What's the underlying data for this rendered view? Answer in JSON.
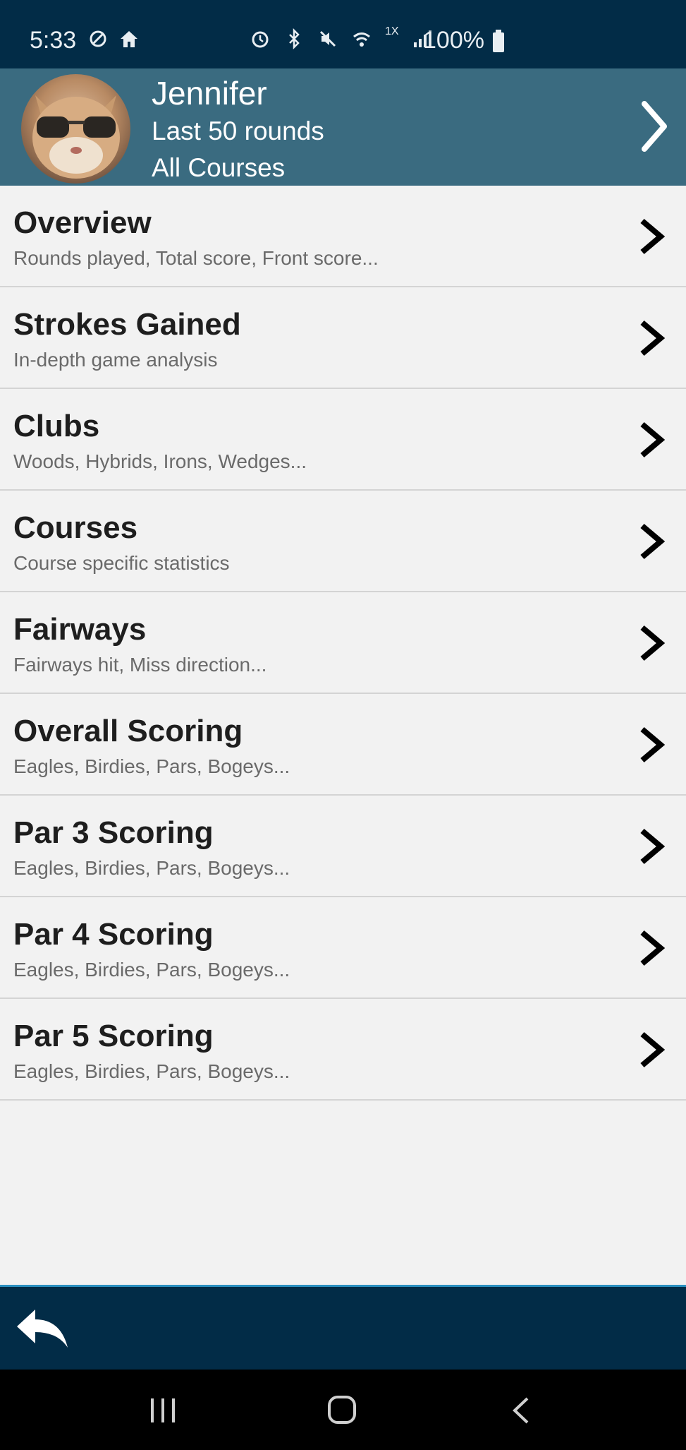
{
  "status_bar": {
    "time": "5:33",
    "network_label": "1X",
    "battery": "100%"
  },
  "profile": {
    "name": "Jennifer",
    "rounds": "Last 50 rounds",
    "courses": "All Courses"
  },
  "menu": {
    "items": [
      {
        "title": "Overview",
        "subtitle": "Rounds played, Total score, Front score..."
      },
      {
        "title": "Strokes Gained",
        "subtitle": "In-depth game analysis"
      },
      {
        "title": "Clubs",
        "subtitle": "Woods, Hybrids, Irons, Wedges..."
      },
      {
        "title": "Courses",
        "subtitle": "Course specific statistics"
      },
      {
        "title": "Fairways",
        "subtitle": "Fairways hit, Miss direction..."
      },
      {
        "title": "Overall Scoring",
        "subtitle": "Eagles, Birdies, Pars, Bogeys..."
      },
      {
        "title": "Par 3 Scoring",
        "subtitle": "Eagles, Birdies, Pars, Bogeys..."
      },
      {
        "title": "Par 4 Scoring",
        "subtitle": "Eagles, Birdies, Pars, Bogeys..."
      },
      {
        "title": "Par 5 Scoring",
        "subtitle": "Eagles, Birdies, Pars, Bogeys..."
      }
    ]
  },
  "colors": {
    "status_bar_bg": "#022c47",
    "header_bg": "#3a6b80",
    "bottom_bar_bg": "#022c47",
    "accent_line": "#2a8fbf"
  },
  "icons": {
    "header": "chevron-right-icon",
    "menu_item": "chevron-right-icon",
    "bottom_bar": "reply-back-icon",
    "nav": [
      "recents-icon",
      "home-icon",
      "back-icon"
    ]
  }
}
